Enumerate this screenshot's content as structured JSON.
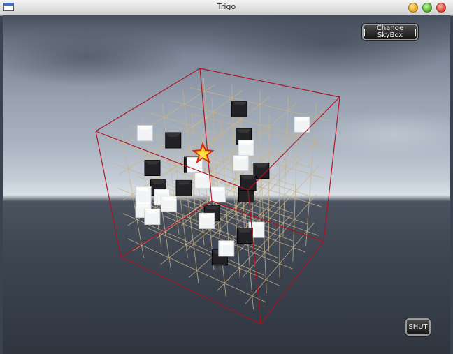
{
  "window": {
    "title": "Trigo"
  },
  "buttons": {
    "change_skybox": "Change SkyBox",
    "shut": "SHUT"
  },
  "scene": {
    "board_size": 5,
    "colors": {
      "frame": "#b01020",
      "grid": "#c9b488",
      "black_stone": "#222226",
      "white_stone": "#f2f4f6"
    },
    "stones_black": 14,
    "stones_white": 14,
    "cursor_icon": "star-cursor-icon"
  }
}
